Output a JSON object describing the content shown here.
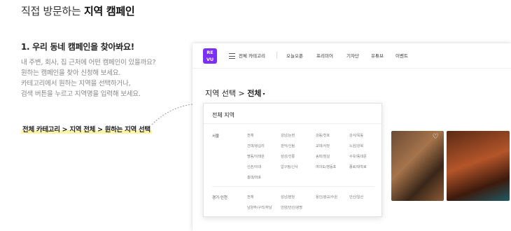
{
  "header": {
    "title_prefix": "직접 방문하는 ",
    "title_bold": "지역 캠페인"
  },
  "step": {
    "title": "1. 우리 동네 캠페인을 찾아봐요!",
    "lines": [
      "내 주변, 회사, 집 근처에 어떤 캠페인이 있을까요?",
      "원하는 캠페인을 찾아 신청해 보세요.",
      "카테고리에서 원하는 지역을 선택하거나,",
      "검색 버튼을 누르고 지역명을 입력해 보세요."
    ],
    "path_hint": "전체 카테고리 > 지역 전체 > 원하는 지역 선택"
  },
  "nav": {
    "logo_top": "RE",
    "logo_bottom": "VU",
    "all_categories": "전체 카테고리",
    "items": [
      "오늘오픈",
      "프리미어",
      "기자단",
      "유튜브",
      "이벤트"
    ]
  },
  "region": {
    "label": "지역 선택 > ",
    "selected": "전체",
    "caret": "▾"
  },
  "icons": {
    "menu": "menu-icon",
    "heart": "heart-icon",
    "arrow": "dotted-arrow"
  },
  "accent": "#7b2ff7",
  "dropdown": {
    "heading": "전체 지역",
    "groups": [
      {
        "label": "서울",
        "cities": [
          [
            "전체",
            "강남/논현",
            "강동/천호",
            "강서/목동"
          ],
          [
            "건대/왕십리",
            "관악/신림",
            "교대/사당",
            "노원/강북"
          ],
          [
            "명동/이태원",
            "삼성/선릉",
            "송파/잠실",
            "수유/동대문"
          ],
          [
            "신촌/이대",
            "압구정/신사",
            "여의도/영등포",
            "종로/대학로"
          ],
          [
            "홍대/마포"
          ]
        ]
      },
      {
        "label": "경기·인천",
        "cities": [
          [
            "전체",
            "성남/분당",
            "용인/광교/수원",
            "안산/일산"
          ],
          [
            "남양주/구리/하남",
            "안양/안산/광명"
          ]
        ]
      }
    ]
  }
}
